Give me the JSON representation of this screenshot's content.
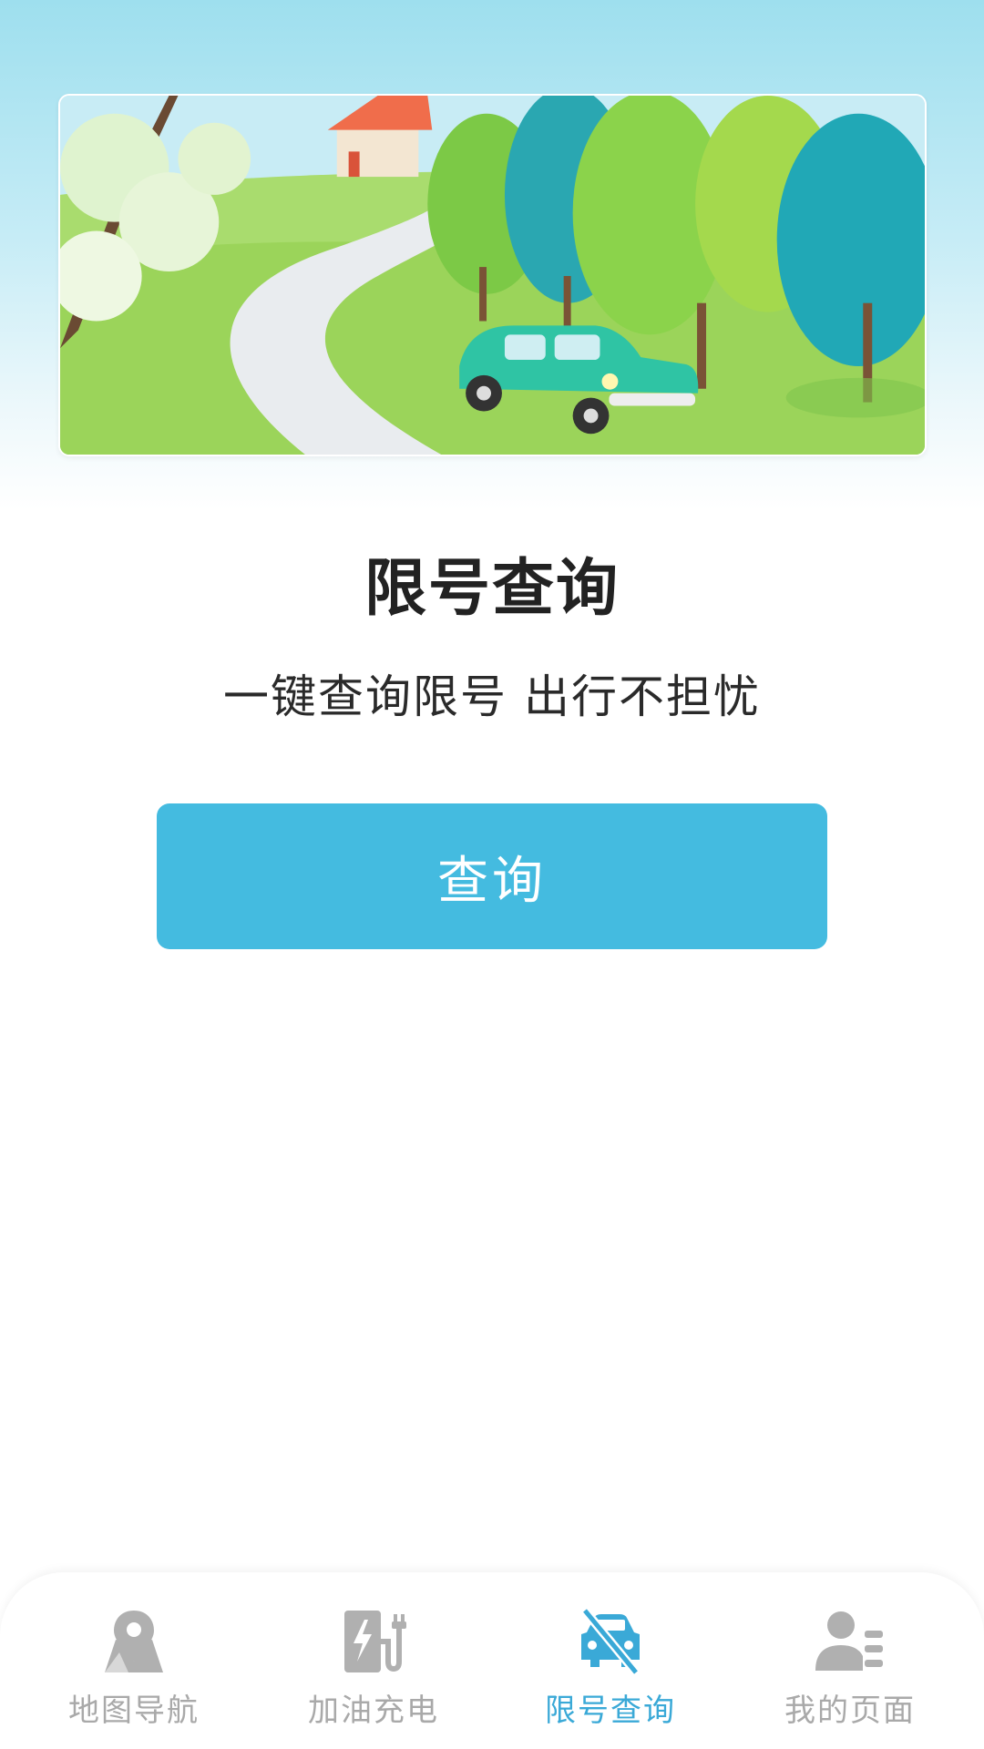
{
  "banner": {
    "alt": "illustration"
  },
  "main": {
    "title": "限号查询",
    "subtitle": "一键查询限号 出行不担忧",
    "query_button": "查询"
  },
  "tabbar": {
    "tabs": [
      {
        "label": "地图导航",
        "icon": "map-pin-icon",
        "active": false
      },
      {
        "label": "加油充电",
        "icon": "fuel-charge-icon",
        "active": false
      },
      {
        "label": "限号查询",
        "icon": "restricted-car-icon",
        "active": true
      },
      {
        "label": "我的页面",
        "icon": "profile-icon",
        "active": false
      }
    ]
  },
  "colors": {
    "accent": "#44bbe0",
    "active_tab": "#3aa9d7",
    "inactive_tab": "#a9a9a9"
  }
}
